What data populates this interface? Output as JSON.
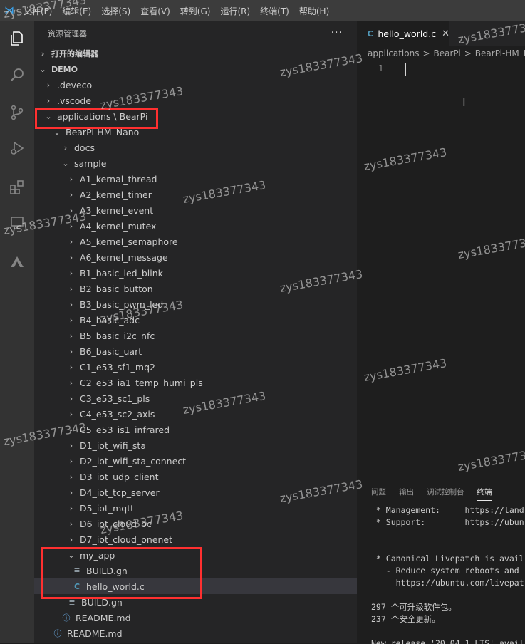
{
  "menubar": {
    "items": [
      "文件(F)",
      "编辑(E)",
      "选择(S)",
      "查看(V)",
      "转到(G)",
      "运行(R)",
      "终端(T)",
      "帮助(H)"
    ]
  },
  "activity_bar": {
    "icons": [
      "explorer-icon",
      "search-icon",
      "source-control-icon",
      "run-debug-icon",
      "extensions-icon",
      "remote-explorer-icon",
      "cloud-icon"
    ]
  },
  "sidebar": {
    "title": "资源管理器",
    "more": "···",
    "open_editors_label": "打开的编辑器",
    "root_label": "DEMO",
    "tree": [
      {
        "label": ".deveco",
        "indent": 1,
        "kind": "folder-closed"
      },
      {
        "label": ".vscode",
        "indent": 1,
        "kind": "folder-closed"
      },
      {
        "label": "applications \\ BearPi",
        "indent": 1,
        "kind": "folder-open"
      },
      {
        "label": "BearPi-HM_Nano",
        "indent": 2,
        "kind": "folder-open"
      },
      {
        "label": "docs",
        "indent": 3,
        "kind": "folder-closed"
      },
      {
        "label": "sample",
        "indent": 3,
        "kind": "folder-open"
      },
      {
        "label": "A1_kernal_thread",
        "indent": 4,
        "kind": "folder-closed"
      },
      {
        "label": "A2_kernel_timer",
        "indent": 4,
        "kind": "folder-closed"
      },
      {
        "label": "A3_kernel_event",
        "indent": 4,
        "kind": "folder-closed"
      },
      {
        "label": "A4_kernel_mutex",
        "indent": 4,
        "kind": "folder-closed"
      },
      {
        "label": "A5_kernel_semaphore",
        "indent": 4,
        "kind": "folder-closed"
      },
      {
        "label": "A6_kernel_message",
        "indent": 4,
        "kind": "folder-closed"
      },
      {
        "label": "B1_basic_led_blink",
        "indent": 4,
        "kind": "folder-closed"
      },
      {
        "label": "B2_basic_button",
        "indent": 4,
        "kind": "folder-closed"
      },
      {
        "label": "B3_basic_pwm_led",
        "indent": 4,
        "kind": "folder-closed"
      },
      {
        "label": "B4_basic_adc",
        "indent": 4,
        "kind": "folder-closed"
      },
      {
        "label": "B5_basic_i2c_nfc",
        "indent": 4,
        "kind": "folder-closed"
      },
      {
        "label": "B6_basic_uart",
        "indent": 4,
        "kind": "folder-closed"
      },
      {
        "label": "C1_e53_sf1_mq2",
        "indent": 4,
        "kind": "folder-closed"
      },
      {
        "label": "C2_e53_ia1_temp_humi_pls",
        "indent": 4,
        "kind": "folder-closed"
      },
      {
        "label": "C3_e53_sc1_pls",
        "indent": 4,
        "kind": "folder-closed"
      },
      {
        "label": "C4_e53_sc2_axis",
        "indent": 4,
        "kind": "folder-closed"
      },
      {
        "label": "C5_e53_is1_infrared",
        "indent": 4,
        "kind": "folder-closed"
      },
      {
        "label": "D1_iot_wifi_sta",
        "indent": 4,
        "kind": "folder-closed"
      },
      {
        "label": "D2_iot_wifi_sta_connect",
        "indent": 4,
        "kind": "folder-closed"
      },
      {
        "label": "D3_iot_udp_client",
        "indent": 4,
        "kind": "folder-closed"
      },
      {
        "label": "D4_iot_tcp_server",
        "indent": 4,
        "kind": "folder-closed"
      },
      {
        "label": "D5_iot_mqtt",
        "indent": 4,
        "kind": "folder-closed"
      },
      {
        "label": "D6_iot_cloud_oc",
        "indent": 4,
        "kind": "folder-closed"
      },
      {
        "label": "D7_iot_cloud_onenet",
        "indent": 4,
        "kind": "folder-closed"
      },
      {
        "label": "my_app",
        "indent": 4,
        "kind": "folder-open"
      },
      {
        "label": "BUILD.gn",
        "indent": 5,
        "kind": "gn"
      },
      {
        "label": "hello_world.c",
        "indent": 5,
        "kind": "c",
        "selected": true
      },
      {
        "label": "BUILD.gn",
        "indent": 4,
        "kind": "gn"
      },
      {
        "label": "README.md",
        "indent": 3,
        "kind": "info"
      },
      {
        "label": "README.md",
        "indent": 2,
        "kind": "info"
      }
    ]
  },
  "editor": {
    "tab": {
      "label": "hello_world.c",
      "icon": "C",
      "close": "✕"
    },
    "breadcrumbs": [
      "applications",
      "BearPi",
      "BearPi-HM_Nano"
    ],
    "breadcrumb_sep": ">",
    "line_number": "1"
  },
  "panel": {
    "tabs": [
      "问题",
      "输出",
      "调试控制台",
      "终端"
    ],
    "active_tab": 3,
    "terminal_lines": [
      " * Management:     https://land",
      " * Support:        https://ubun",
      "",
      "",
      " * Canonical Livepatch is avail",
      "   - Reduce system reboots and",
      "     https://ubuntu.com/livepat",
      "",
      "297 个可升级软件包。",
      "237 个安全更新。",
      "",
      "New release '20.04.1 LTS' avail"
    ]
  },
  "watermark": "zys183377343",
  "colors": {
    "accent": "#007acc",
    "annotation_red": "#ff3030",
    "c_file": "#519aba"
  }
}
